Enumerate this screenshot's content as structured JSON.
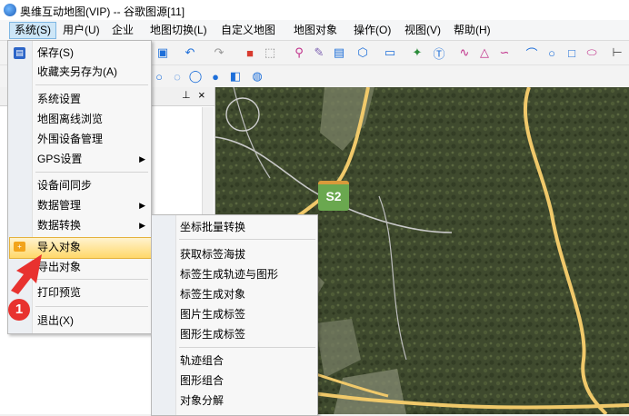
{
  "window": {
    "title": "奥维互动地图(VIP) -- 谷歌图源[11]"
  },
  "menubar": [
    "系统(S)",
    "用户(U)",
    "企业",
    "地图切换(L)",
    "自定义地图",
    "地图对象",
    "操作(O)",
    "视图(V)",
    "帮助(H)"
  ],
  "system_menu": {
    "items": {
      "save": "保存(S)",
      "save_favorites_as": "收藏夹另存为(A)",
      "settings": "系统设置",
      "offline_browse": "地图离线浏览",
      "peripheral": "外围设备管理",
      "gps": "GPS设置",
      "sync": "设备间同步",
      "data_mgmt": "数据管理",
      "data_convert": "数据转换",
      "import": "导入对象",
      "export": "导出对象",
      "print_preview": "打印预览",
      "exit": "退出(X)"
    }
  },
  "submenu": {
    "items": {
      "coord_batch": "坐标批量转换",
      "get_label_altitude": "获取标签海拔",
      "label_to_track": "标签生成轨迹与图形",
      "label_to_object": "标签生成对象",
      "image_to_label": "图片生成标签",
      "shape_to_label": "图形生成标签",
      "track_combine": "轨迹组合",
      "shape_combine": "图形组合",
      "object_split": "对象分解"
    }
  },
  "map": {
    "marker_label": "S2"
  },
  "annotation": {
    "step": "1"
  },
  "colors": {
    "accent_red": "#e8322f",
    "highlight": "#ffd86a",
    "marker_green": "#6aa84f",
    "map_road": "#e8c26a"
  }
}
